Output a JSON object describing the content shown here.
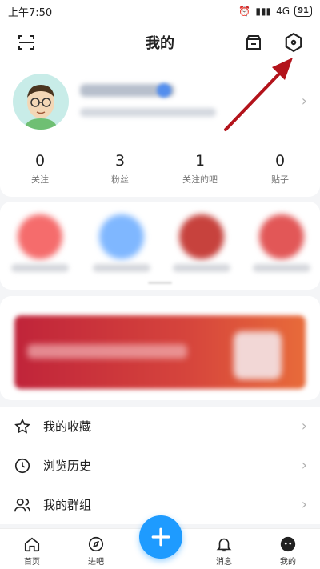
{
  "status_bar": {
    "time": "上午7:50",
    "network": "4G",
    "battery": "91"
  },
  "header": {
    "title": "我的"
  },
  "stats": [
    {
      "value": "0",
      "label": "关注"
    },
    {
      "value": "3",
      "label": "粉丝"
    },
    {
      "value": "1",
      "label": "关注的吧"
    },
    {
      "value": "0",
      "label": "贴子"
    }
  ],
  "menu": [
    {
      "label": "我的收藏",
      "icon": "star-icon"
    },
    {
      "label": "浏览历史",
      "icon": "clock-icon"
    },
    {
      "label": "我的群组",
      "icon": "group-icon"
    }
  ],
  "tabbar": {
    "home": "首页",
    "enter": "进吧",
    "messages": "消息",
    "mine": "我的"
  },
  "colors": {
    "accent": "#1e9bff",
    "annotation": "#b3131b"
  }
}
